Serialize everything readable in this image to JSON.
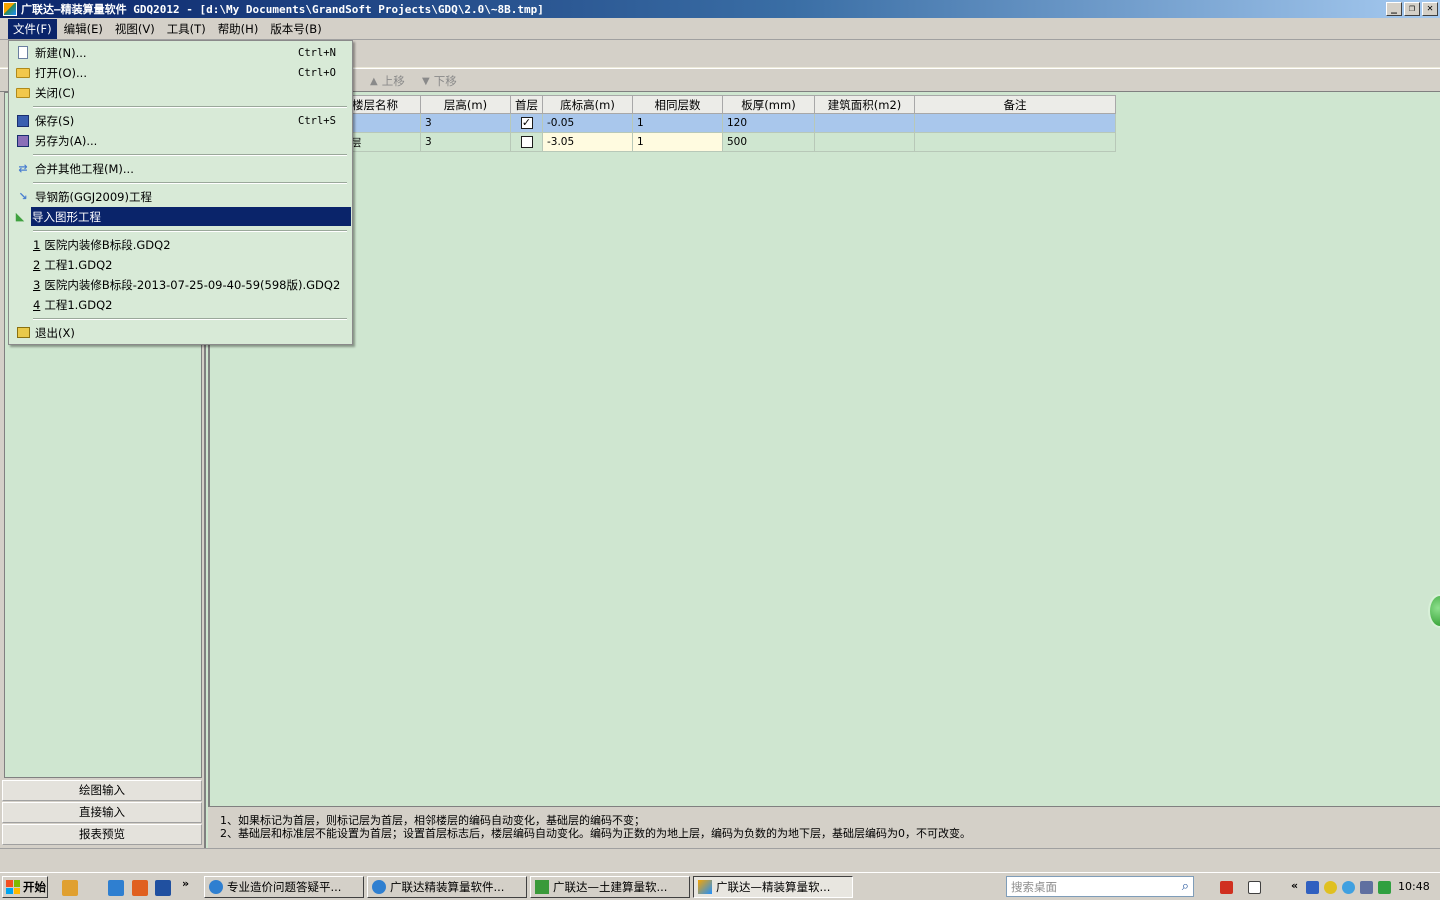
{
  "window": {
    "title": "广联达—精装算量软件 GDQ2012 - [d:\\My Documents\\GrandSoft Projects\\GDQ\\2.0\\~8B.tmp]",
    "buttons": [
      "_",
      "❐",
      "✕"
    ]
  },
  "menubar": {
    "items": [
      "文件(F)",
      "编辑(E)",
      "视图(V)",
      "工具(T)",
      "帮助(H)",
      "版本号(B)"
    ]
  },
  "file_menu": {
    "new": {
      "label": "新建(N)...",
      "shortcut": "Ctrl+N"
    },
    "open": {
      "label": "打开(O)...",
      "shortcut": "Ctrl+O"
    },
    "close": {
      "label": "关闭(C)"
    },
    "save": {
      "label": "保存(S)",
      "shortcut": "Ctrl+S"
    },
    "save_as": {
      "label": "另存为(A)..."
    },
    "merge": {
      "label": "合并其他工程(M)..."
    },
    "import_rebar": {
      "label": "导钢筋(GGJ2009)工程"
    },
    "import_graphic": {
      "label": "导入图形工程"
    },
    "recent": [
      {
        "num": "1",
        "label": "医院内装修B标段.GDQ2"
      },
      {
        "num": "2",
        "label": "工程1.GDQ2"
      },
      {
        "num": "3",
        "label": "医院内装修B标段-2013-07-25-09-40-59(598版).GDQ2"
      },
      {
        "num": "4",
        "label": "工程1.GDQ2"
      }
    ],
    "exit": {
      "label": "退出(X)"
    }
  },
  "toolbar": {
    "move_up": "上移",
    "move_down": "下移"
  },
  "grid": {
    "headers": [
      "楼层名称",
      "层高(m)",
      "首层",
      "底标高(m)",
      "相同层数",
      "板厚(mm)",
      "建筑面积(m2)",
      "备注"
    ],
    "rows": [
      {
        "name": "",
        "height": "3",
        "first": true,
        "base": "-0.05",
        "same": "1",
        "thickness": "120",
        "area": "",
        "note": ""
      },
      {
        "name": "层",
        "height": "3",
        "first": false,
        "base": "-3.05",
        "same": "1",
        "thickness": "500",
        "area": "",
        "note": ""
      }
    ]
  },
  "left_nav": {
    "buttons": [
      "绘图输入",
      "直接输入",
      "报表预览"
    ]
  },
  "hints": {
    "line1": "1、如果标记为首层，则标记层为首层，相邻楼层的编码自动变化，基础层的编码不变；",
    "line2": "2、基础层和标准层不能设置为首层；设置首层标志后，楼层编码自动变化。编码为正数的为地上层，编码为负数的为地下层，基础层编码为0，不可改变。"
  },
  "taskbar": {
    "start": "开始",
    "tasks": [
      {
        "label": "专业造价问题答疑平...",
        "pressed": false
      },
      {
        "label": "广联达精装算量软件...",
        "pressed": false
      },
      {
        "label": "广联达—土建算量软...",
        "pressed": false
      },
      {
        "label": "广联达—精装算量软...",
        "pressed": true
      }
    ],
    "search_placeholder": "搜索桌面",
    "clock": "10:48",
    "more": "»",
    "tray_expand": "«"
  }
}
